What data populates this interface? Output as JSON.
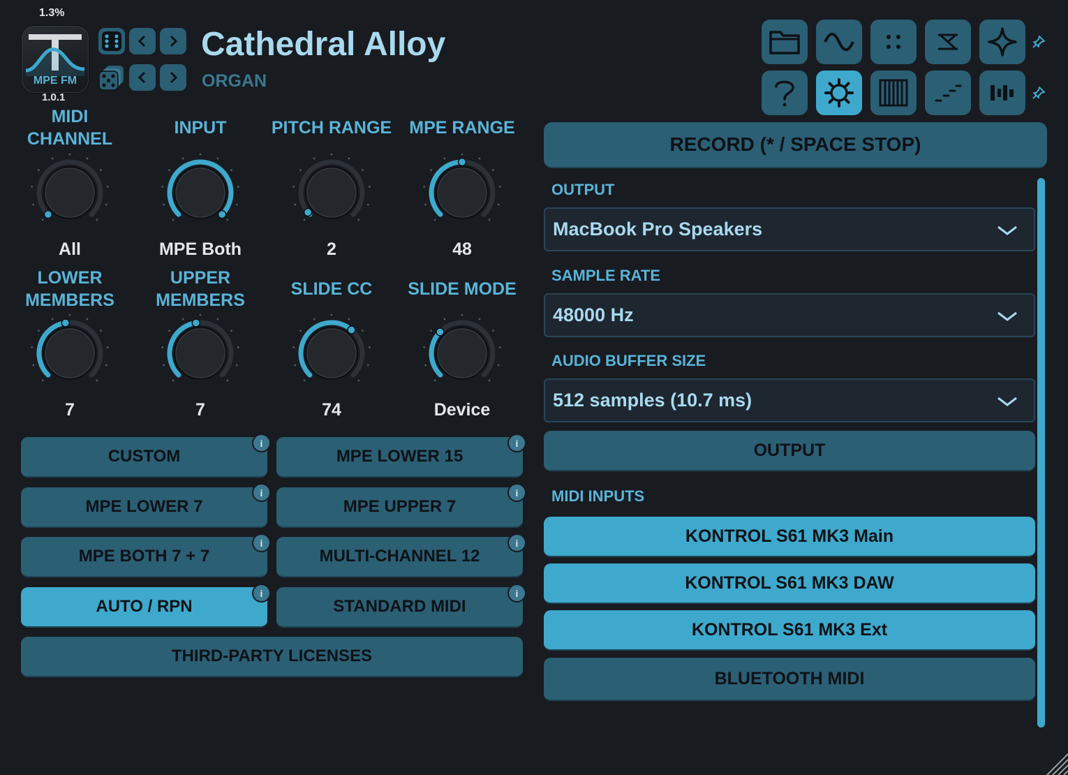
{
  "header": {
    "cpu_load": "1.3%",
    "logo_text": "MPE FM",
    "version": "1.0.1",
    "preset_name": "Cathedral Alloy",
    "preset_category": "ORGAN"
  },
  "toolbar": {
    "row1": [
      {
        "icon": "folder-icon"
      },
      {
        "icon": "sine-wave-icon"
      },
      {
        "icon": "dots-grid-icon"
      },
      {
        "icon": "routing-icon"
      },
      {
        "icon": "sparkle-icon"
      }
    ],
    "row2": [
      {
        "icon": "help-icon"
      },
      {
        "icon": "gear-icon",
        "active": true
      },
      {
        "icon": "piano-keys-icon"
      },
      {
        "icon": "steps-icon"
      },
      {
        "icon": "bars-icon"
      }
    ]
  },
  "knobs": [
    {
      "label": "MIDI\nCHANNEL",
      "value": "All",
      "level": 0.0
    },
    {
      "label": "INPUT",
      "value": "MPE Both",
      "level": 1.0
    },
    {
      "label": "PITCH RANGE",
      "value": "2",
      "level": 0.02
    },
    {
      "label": "MPE RANGE",
      "value": "48",
      "level": 0.5
    },
    {
      "label": "LOWER\nMEMBERS",
      "value": "7",
      "level": 0.47
    },
    {
      "label": "UPPER\nMEMBERS",
      "value": "7",
      "level": 0.47
    },
    {
      "label": "SLIDE CC",
      "value": "74",
      "level": 0.65
    },
    {
      "label": "SLIDE MODE",
      "value": "Device",
      "level": 0.33
    }
  ],
  "presets": [
    {
      "label": "CUSTOM",
      "info": "i"
    },
    {
      "label": "MPE LOWER 15",
      "info": "i"
    },
    {
      "label": "MPE LOWER 7",
      "info": "i"
    },
    {
      "label": "MPE UPPER 7",
      "info": "i"
    },
    {
      "label": "MPE BOTH 7 + 7",
      "info": "i"
    },
    {
      "label": "MULTI-CHANNEL 12",
      "info": "i"
    },
    {
      "label": "AUTO / RPN",
      "info": "i",
      "selected": true
    },
    {
      "label": "STANDARD MIDI",
      "info": "i"
    }
  ],
  "licenses_label": "THIRD-PARTY LICENSES",
  "audio": {
    "record_label": "RECORD (* / SPACE STOP)",
    "output_label": "OUTPUT",
    "output_value": "MacBook Pro Speakers",
    "sample_rate_label": "SAMPLE RATE",
    "sample_rate_value": "48000 Hz",
    "buffer_label": "AUDIO BUFFER SIZE",
    "buffer_value": "512 samples (10.7 ms)",
    "output_button": "OUTPUT",
    "midi_inputs_label": "MIDI INPUTS",
    "midi_inputs": [
      {
        "label": "KONTROL S61 MK3 Main",
        "enabled": true
      },
      {
        "label": "KONTROL S61 MK3 DAW",
        "enabled": true
      },
      {
        "label": "KONTROL S61 MK3 Ext",
        "enabled": true
      },
      {
        "label": "BLUETOOTH MIDI",
        "enabled": false
      }
    ]
  },
  "colors": {
    "accent": "#3ea9cc",
    "button": "#2b5f74",
    "label": "#5ab4d8",
    "title": "#a9d9ee",
    "background": "#181b20"
  }
}
